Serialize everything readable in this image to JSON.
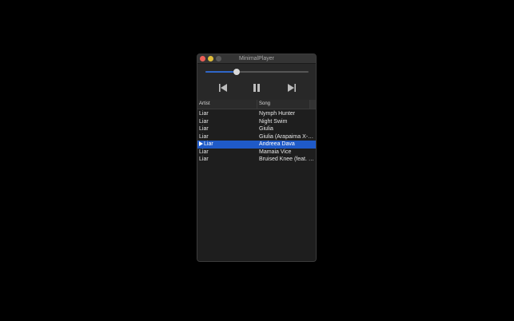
{
  "window": {
    "title": "MinimalPlayer"
  },
  "playback": {
    "progress": 0.3,
    "state": "playing"
  },
  "icons": {
    "previous": "skip-back-icon",
    "pause": "pause-icon",
    "next": "skip-forward-icon",
    "now_playing": "play-triangle-icon"
  },
  "colors": {
    "accent": "#1f5ac8",
    "close": "#ec5f57",
    "minimize": "#e0bd3a"
  },
  "table": {
    "columns": [
      "Artist",
      "Song"
    ],
    "rows": [
      {
        "artist": "Liar",
        "song": "Nymph Hunter",
        "playing": false
      },
      {
        "artist": "Liar",
        "song": "Night Swim",
        "playing": false
      },
      {
        "artist": "Liar",
        "song": "Giulia",
        "playing": false
      },
      {
        "artist": "Liar",
        "song": "Giulia (Arapaima X-M...",
        "playing": false
      },
      {
        "artist": "Liar",
        "song": "Andreea Dava",
        "playing": true
      },
      {
        "artist": "Liar",
        "song": "Mamaia Vice",
        "playing": false
      },
      {
        "artist": "Liar",
        "song": "Bruised Knee (feat. B...",
        "playing": false
      }
    ]
  }
}
